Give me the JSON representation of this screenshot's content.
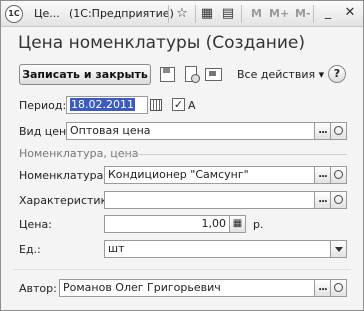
{
  "titlebar": {
    "app_short": "Це...",
    "app_full": "(1С:Предприятие)",
    "m_buttons": [
      "M",
      "M+",
      "M-"
    ]
  },
  "form": {
    "heading": "Цена номенклатуры (Создание)",
    "save_close_label": "Записать и закрыть",
    "all_actions_label": "Все действия ▾",
    "help_label": "?"
  },
  "fields": {
    "period": {
      "label": "Период:",
      "value": "18.02.2011",
      "checkbox_label": "A",
      "checked": true
    },
    "price_type": {
      "label": "Вид цен:",
      "value": "Оптовая цена"
    },
    "section_label": "Номенклатура, цена",
    "nomenclature": {
      "label": "Номенклатура:",
      "value": "Кондиционер \"Самсунг\""
    },
    "characteristic": {
      "label": "Характеристика:",
      "value": ""
    },
    "price": {
      "label": "Цена:",
      "value": "1,00",
      "unit": "р."
    },
    "unit": {
      "label": "Ед.:",
      "value": "шт"
    },
    "author": {
      "label": "Автор:",
      "value": "Романов Олег Григорьевич"
    }
  },
  "icons": {
    "app": "1c-logo-icon",
    "star": "star-icon",
    "calculator": "calculator-icon",
    "calendar": "calendar-icon",
    "select": "ellipsis-select-icon",
    "open": "magnifier-open-icon",
    "dropdown": "chevron-down-icon",
    "save": "floppy-save-icon",
    "doc": "document-gear-icon",
    "display": "screen-icon",
    "minimize": "minimize-icon",
    "close": "close-icon"
  }
}
